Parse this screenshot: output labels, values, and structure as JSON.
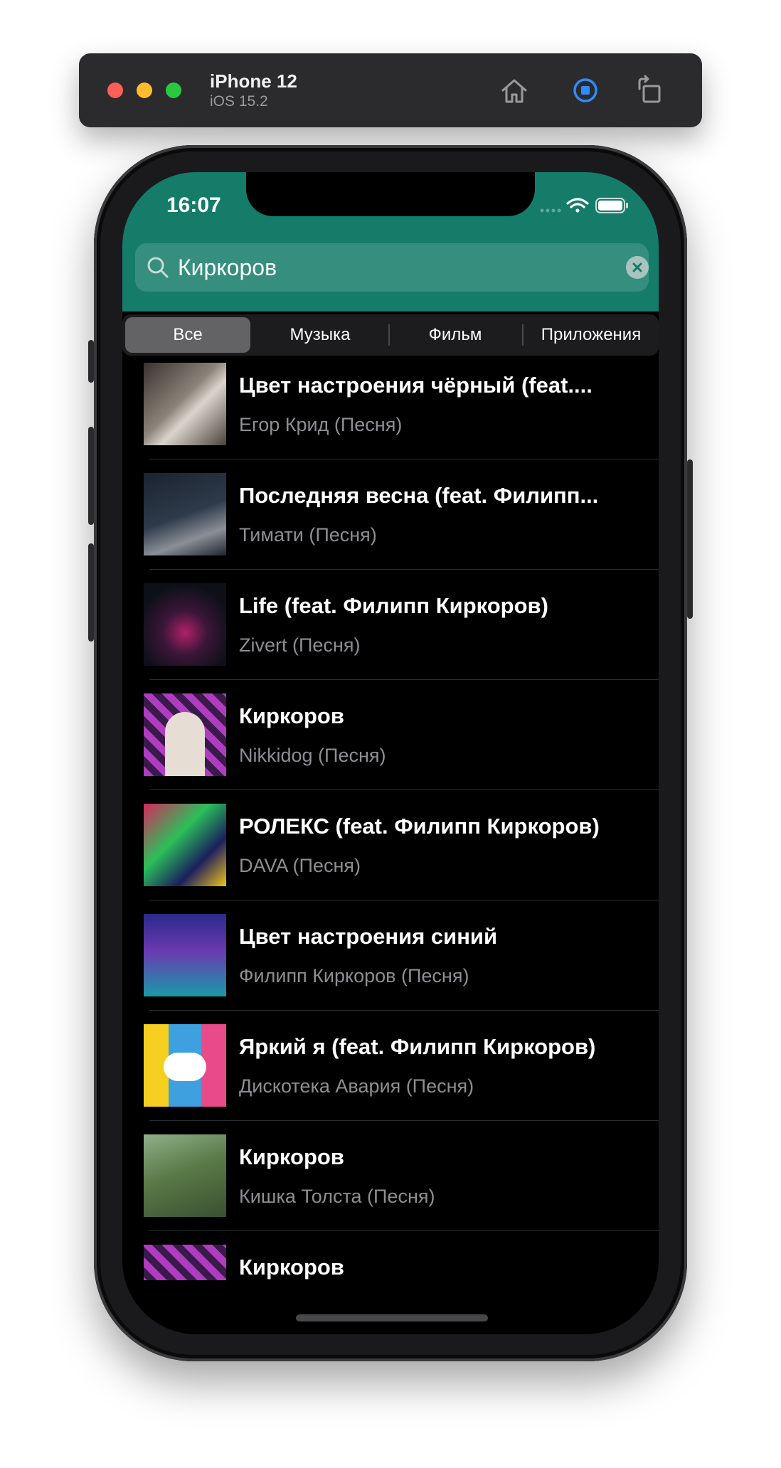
{
  "simulator": {
    "device": "iPhone 12",
    "os": "iOS 15.2"
  },
  "status_bar": {
    "time": "16:07"
  },
  "search": {
    "query": "Киркоров"
  },
  "segments": [
    {
      "label": "Все",
      "selected": true
    },
    {
      "label": "Музыка",
      "selected": false
    },
    {
      "label": "Фильм",
      "selected": false
    },
    {
      "label": "Приложения",
      "selected": false
    }
  ],
  "results": [
    {
      "title": "Цвет настроения чёрный (feat....",
      "subtitle": "Егор Крид (Песня)"
    },
    {
      "title": "Последняя весна (feat. Филипп...",
      "subtitle": "Тимати (Песня)"
    },
    {
      "title": "Life (feat. Филипп Киркоров)",
      "subtitle": "Zivert (Песня)"
    },
    {
      "title": "Киркоров",
      "subtitle": "Nikkidog (Песня)"
    },
    {
      "title": "РОЛЕКС (feat. Филипп Киркоров)",
      "subtitle": "DAVA (Песня)"
    },
    {
      "title": "Цвет настроения синий",
      "subtitle": "Филипп Киркоров (Песня)"
    },
    {
      "title": "Яркий я (feat. Филипп Киркоров)",
      "subtitle": "Дискотека Авария (Песня)"
    },
    {
      "title": "Киркоров",
      "subtitle": "Кишка Толста (Песня)"
    },
    {
      "title": "Киркоров",
      "subtitle": ""
    }
  ],
  "colors": {
    "header": "#157c6a",
    "background": "#000000",
    "subtitle": "#8e8e93"
  }
}
